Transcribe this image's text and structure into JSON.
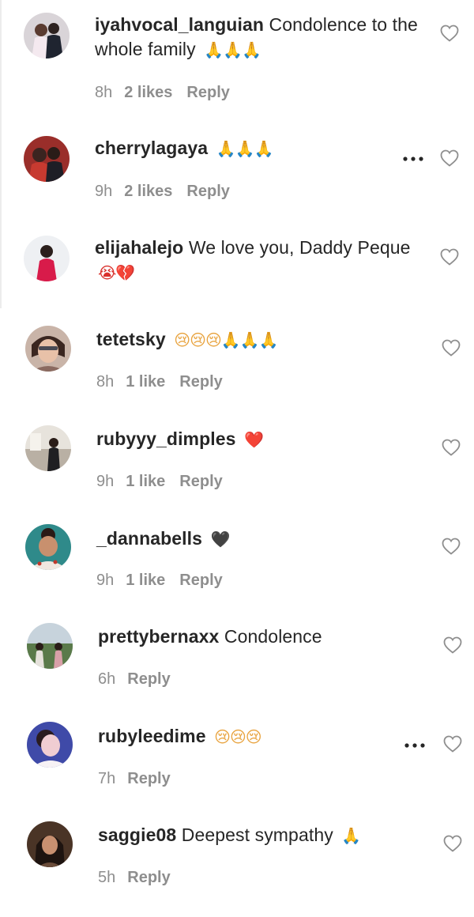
{
  "comments": [
    {
      "username": "iyahvocal_languian",
      "text": " Condolence to the whole family ",
      "emoji": "🙏🙏🙏",
      "time": "8h",
      "likes": "2 likes",
      "reply": "Reply"
    },
    {
      "username": "cherrylagaya",
      "text": " ",
      "emoji": "🙏🙏🙏",
      "time": "9h",
      "likes": "2 likes",
      "reply": "Reply"
    },
    {
      "username": "elijahalejo",
      "text": " We love you, Daddy Peque",
      "emoji": "😭💔",
      "time": "",
      "likes": "",
      "reply": ""
    },
    {
      "username": "tetetsky",
      "text": " ",
      "emoji": "😢😢😢🙏🙏🙏",
      "time": "8h",
      "likes": "1 like",
      "reply": "Reply"
    },
    {
      "username": "rubyyy_dimples",
      "text": " ",
      "emoji": "❤️",
      "time": "9h",
      "likes": "1 like",
      "reply": "Reply"
    },
    {
      "username": "_dannabells",
      "text": " ",
      "emoji": "🖤",
      "time": "9h",
      "likes": "1 like",
      "reply": "Reply"
    },
    {
      "username": "prettybernaxx",
      "text": " Condolence",
      "emoji": "",
      "time": "6h",
      "likes": "",
      "reply": "Reply"
    },
    {
      "username": "rubyleedime",
      "text": " ",
      "emoji": "😢😢😢",
      "time": "7h",
      "likes": "",
      "reply": "Reply"
    },
    {
      "username": "saggie08",
      "text": " Deepest sympathy ",
      "emoji": "🙏",
      "time": "5h",
      "likes": "",
      "reply": "Reply"
    }
  ],
  "icons": {
    "like": "heart-outline-icon",
    "more": "ellipsis-icon"
  },
  "colors": {
    "text": "#262626",
    "meta": "#8e8e8e",
    "heart_stroke": "#8e8e8e",
    "emoji_accent": "#e8a23c"
  }
}
